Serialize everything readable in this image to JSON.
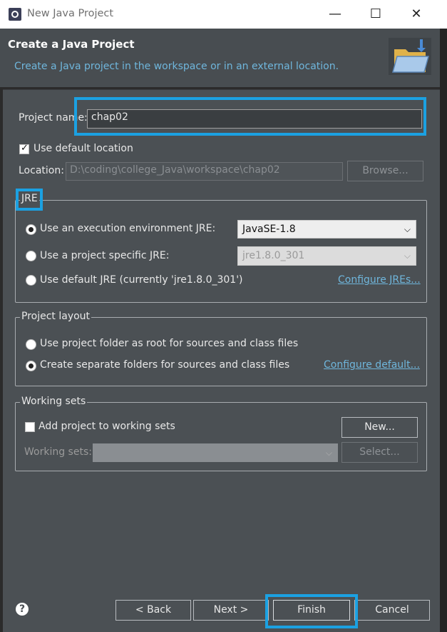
{
  "window": {
    "title": "New Java Project"
  },
  "header": {
    "title": "Create a Java Project",
    "description": "Create a Java project in the workspace or in an external location."
  },
  "project": {
    "name_label": "Project name:",
    "name_value": "chap02",
    "default_location_label": "Use default location",
    "default_location_checked": true,
    "location_label": "Location:",
    "location_value": "D:\\coding\\college_Java\\workspace\\chap02",
    "browse_label": "Browse..."
  },
  "jre": {
    "legend": "JRE",
    "options": [
      {
        "label": "Use an execution environment JRE:",
        "selected": true,
        "combo": "JavaSE-1.8"
      },
      {
        "label": "Use a project specific JRE:",
        "selected": false,
        "combo": "jre1.8.0_301"
      },
      {
        "label": "Use default JRE (currently 'jre1.8.0_301')",
        "selected": false
      }
    ],
    "configure_link": "Configure JREs..."
  },
  "layout": {
    "legend": "Project layout",
    "options": [
      {
        "label": "Use project folder as root for sources and class files",
        "selected": false
      },
      {
        "label": "Create separate folders for sources and class files",
        "selected": true
      }
    ],
    "configure_link": "Configure default..."
  },
  "working_sets": {
    "legend": "Working sets",
    "add_label": "Add project to working sets",
    "add_checked": false,
    "new_button": "New...",
    "sets_label": "Working sets:",
    "sets_value": "",
    "select_button": "Select..."
  },
  "footer": {
    "back": "< Back",
    "next": "Next >",
    "finish": "Finish",
    "cancel": "Cancel"
  },
  "colors": {
    "accent": "#1ba1e2",
    "link": "#6fb6dc",
    "background": "#4b5054"
  }
}
